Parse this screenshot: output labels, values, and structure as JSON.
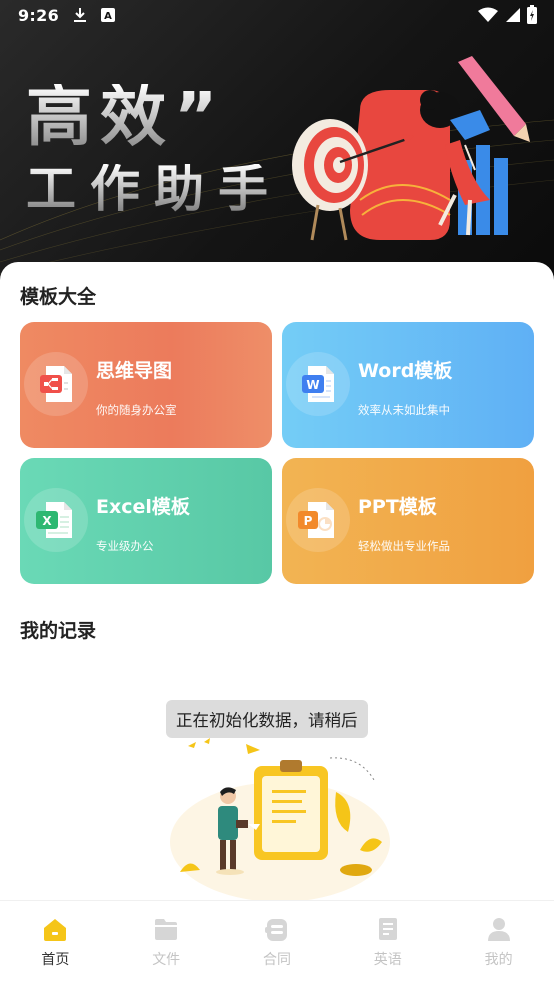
{
  "status_bar": {
    "time": "9:26"
  },
  "banner": {
    "line1": "高效”",
    "line2": "工作助手"
  },
  "templates": {
    "title": "模板大全",
    "items": [
      {
        "title": "思维导图",
        "subtitle": "你的随身办公室",
        "icon": "mindmap-file-icon"
      },
      {
        "title": "Word模板",
        "subtitle": "效率从未如此集中",
        "icon": "word-file-icon"
      },
      {
        "title": "Excel模板",
        "subtitle": "专业级办公",
        "icon": "excel-file-icon"
      },
      {
        "title": "PPT模板",
        "subtitle": "轻松做出专业作品",
        "icon": "ppt-file-icon"
      }
    ]
  },
  "records": {
    "title": "我的记录",
    "toast": "正在初始化数据，请稍后"
  },
  "nav": {
    "items": [
      {
        "label": "首页",
        "icon": "home-icon",
        "active": true
      },
      {
        "label": "文件",
        "icon": "folder-icon",
        "active": false
      },
      {
        "label": "合同",
        "icon": "contract-icon",
        "active": false
      },
      {
        "label": "英语",
        "icon": "book-icon",
        "active": false
      },
      {
        "label": "我的",
        "icon": "profile-icon",
        "active": false
      }
    ]
  },
  "colors": {
    "accent": "#f5c518",
    "mindmap": "#ec7b5c",
    "word": "#5fb0f5",
    "excel": "#58c8a5",
    "ppt": "#f0a040"
  }
}
